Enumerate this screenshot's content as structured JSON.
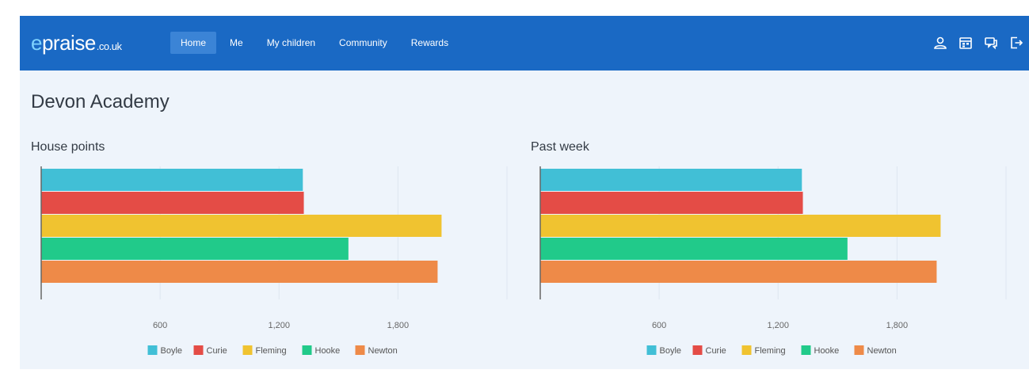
{
  "brand": {
    "prefix": "e",
    "name": "praise",
    "tld": ".co.uk"
  },
  "nav": {
    "items": [
      {
        "label": "Home",
        "active": true
      },
      {
        "label": "Me",
        "active": false
      },
      {
        "label": "My children",
        "active": false
      },
      {
        "label": "Community",
        "active": false
      },
      {
        "label": "Rewards",
        "active": false
      }
    ]
  },
  "header_icons": [
    "user-icon",
    "calendar-icon",
    "chat-icon",
    "logout-icon"
  ],
  "page": {
    "title": "Devon Academy"
  },
  "colors": {
    "nav_bar": "#1a69c4",
    "Boyle": "#41bfd6",
    "Curie": "#e44c46",
    "Fleming": "#f0c330",
    "Hooke": "#21ca8a",
    "Newton": "#ee8a48"
  },
  "chart_data": [
    {
      "type": "bar",
      "orientation": "horizontal",
      "title": "House points",
      "categories": [
        "Boyle",
        "Curie",
        "Fleming",
        "Hooke",
        "Newton"
      ],
      "values": [
        1320,
        1325,
        2020,
        1550,
        2000
      ],
      "xticks": [
        "600",
        "1,200",
        "1,800"
      ],
      "xtick_values": [
        600,
        1200,
        1800
      ],
      "xlim": [
        0,
        2350
      ],
      "grid": true,
      "legend": "bottom"
    },
    {
      "type": "bar",
      "orientation": "horizontal",
      "title": "Past week",
      "categories": [
        "Boyle",
        "Curie",
        "Fleming",
        "Hooke",
        "Newton"
      ],
      "values": [
        1320,
        1325,
        2020,
        1550,
        2000
      ],
      "xticks": [
        "600",
        "1,200",
        "1,800"
      ],
      "xtick_values": [
        600,
        1200,
        1800
      ],
      "xlim": [
        0,
        2350
      ],
      "grid": true,
      "legend": "bottom"
    }
  ]
}
